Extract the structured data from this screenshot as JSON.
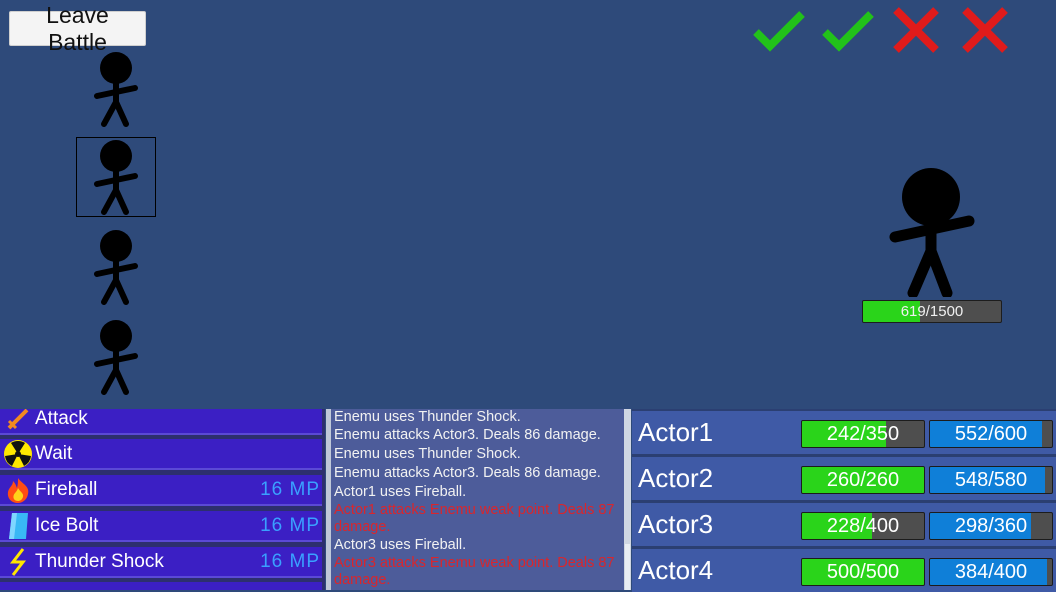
{
  "leave_button": "Leave Battle",
  "party_figures": 4,
  "selected_party_slot": 1,
  "results": [
    {
      "icon": "check-icon",
      "color": "#22c21a"
    },
    {
      "icon": "check-icon",
      "color": "#22c21a"
    },
    {
      "icon": "cross-icon",
      "color": "#e01b1b"
    },
    {
      "icon": "cross-icon",
      "color": "#e01b1b"
    }
  ],
  "enemy": {
    "hp_text": "619/1500",
    "hp": 619,
    "hp_max": 1500
  },
  "commands": [
    {
      "icon": "sword-icon",
      "label": "Attack",
      "cost": ""
    },
    {
      "icon": "radiation-icon",
      "label": "Wait",
      "cost": ""
    },
    {
      "icon": "fire-icon",
      "label": "Fireball",
      "cost": "16 MP"
    },
    {
      "icon": "ice-icon",
      "label": "Ice Bolt",
      "cost": "16 MP"
    },
    {
      "icon": "lightning-icon",
      "label": "Thunder Shock",
      "cost": "16 MP"
    }
  ],
  "log": [
    {
      "text": "Enemu uses Thunder Shock.",
      "hit": false
    },
    {
      "text": "Enemu attacks Actor3. Deals 86 damage.",
      "hit": false
    },
    {
      "text": "Enemu uses Thunder Shock.",
      "hit": false
    },
    {
      "text": "Enemu attacks Actor3. Deals 86 damage.",
      "hit": false
    },
    {
      "text": "Actor1 uses Fireball.",
      "hit": false
    },
    {
      "text": "Actor1 attacks Enemu weak point. Deals 87 damage.",
      "hit": true
    },
    {
      "text": "Actor3 uses Fireball.",
      "hit": false
    },
    {
      "text": "Actor3 attacks Enemu weak point. Deals 87 damage.",
      "hit": true
    }
  ],
  "actors": [
    {
      "name": "Actor1",
      "hp_text": "242/350",
      "hp": 242,
      "hp_max": 350,
      "mp_text": "552/600",
      "mp": 552,
      "mp_max": 600
    },
    {
      "name": "Actor2",
      "hp_text": "260/260",
      "hp": 260,
      "hp_max": 260,
      "mp_text": "548/580",
      "mp": 548,
      "mp_max": 580
    },
    {
      "name": "Actor3",
      "hp_text": "228/400",
      "hp": 228,
      "hp_max": 400,
      "mp_text": "298/360",
      "mp": 298,
      "mp_max": 360
    },
    {
      "name": "Actor4",
      "hp_text": "500/500",
      "hp": 500,
      "hp_max": 500,
      "mp_text": "384/400",
      "mp": 384,
      "mp_max": 400
    }
  ]
}
